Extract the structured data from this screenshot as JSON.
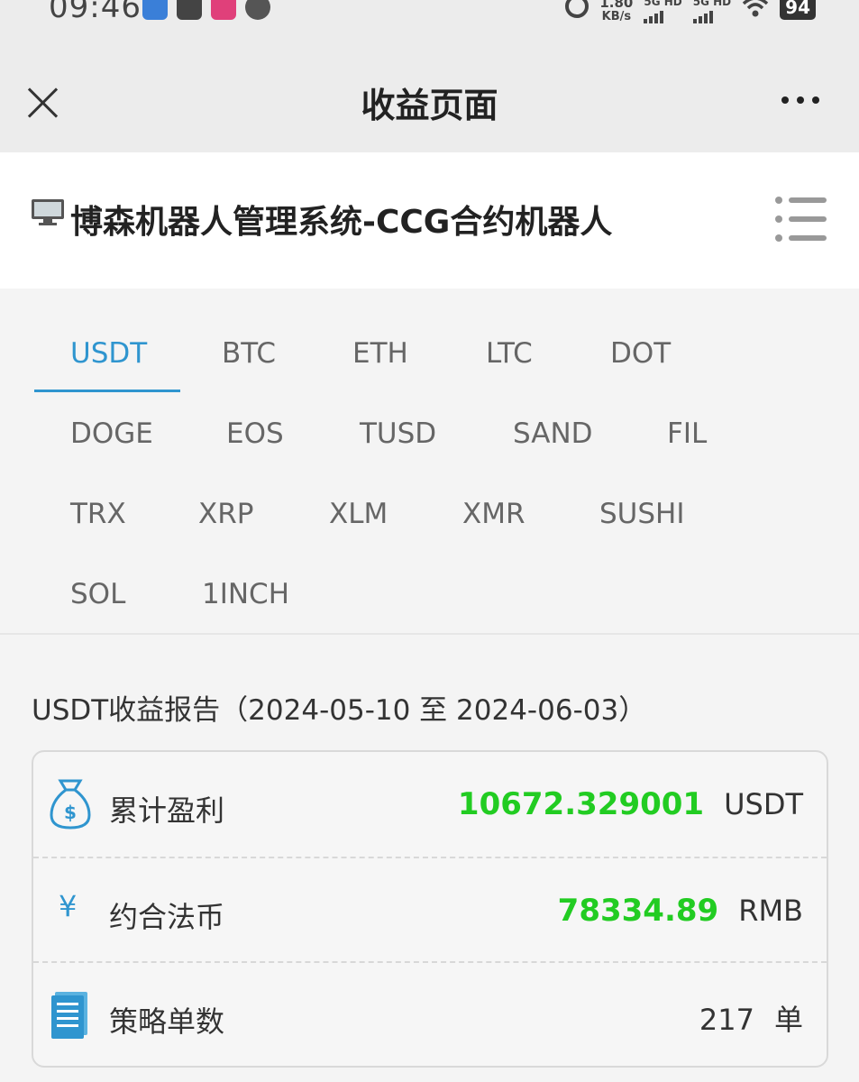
{
  "status_bar": {
    "time": "09:46",
    "net_speed": "1.80",
    "net_unit": "KB/s",
    "signal1": "5G HD",
    "signal2": "5G HD",
    "battery": "94"
  },
  "nav": {
    "title": "收益页面",
    "close_icon": "close-icon",
    "more_icon": "more-icon"
  },
  "header": {
    "title": "博森机器人管理系统-CCG合约机器人",
    "icon": "monitor-icon",
    "menu_icon": "list-menu-icon"
  },
  "tabs": {
    "active": "USDT",
    "row1": [
      "USDT",
      "BTC",
      "ETH",
      "LTC",
      "DOT"
    ],
    "row2": [
      "DOGE",
      "EOS",
      "TUSD",
      "SAND",
      "FIL"
    ],
    "row3": [
      "TRX",
      "XRP",
      "XLM",
      "XMR",
      "SUSHI"
    ],
    "row4": [
      "SOL",
      "1INCH"
    ]
  },
  "report": {
    "title": "USDT收益报告（2024-05-10 至 2024-06-03）",
    "rows": [
      {
        "icon": "money-bag-icon",
        "label": "累计盈利",
        "value": "10672.329001",
        "unit": "USDT",
        "highlight": true
      },
      {
        "icon": "yuan-icon",
        "label": "约合法币",
        "value": "78334.89",
        "unit": "RMB",
        "highlight": true
      },
      {
        "icon": "document-icon",
        "label": "策略单数",
        "value": "217",
        "unit": "单",
        "highlight": false
      }
    ]
  },
  "colors": {
    "accent": "#2f95cf",
    "profit": "#22cc22"
  }
}
